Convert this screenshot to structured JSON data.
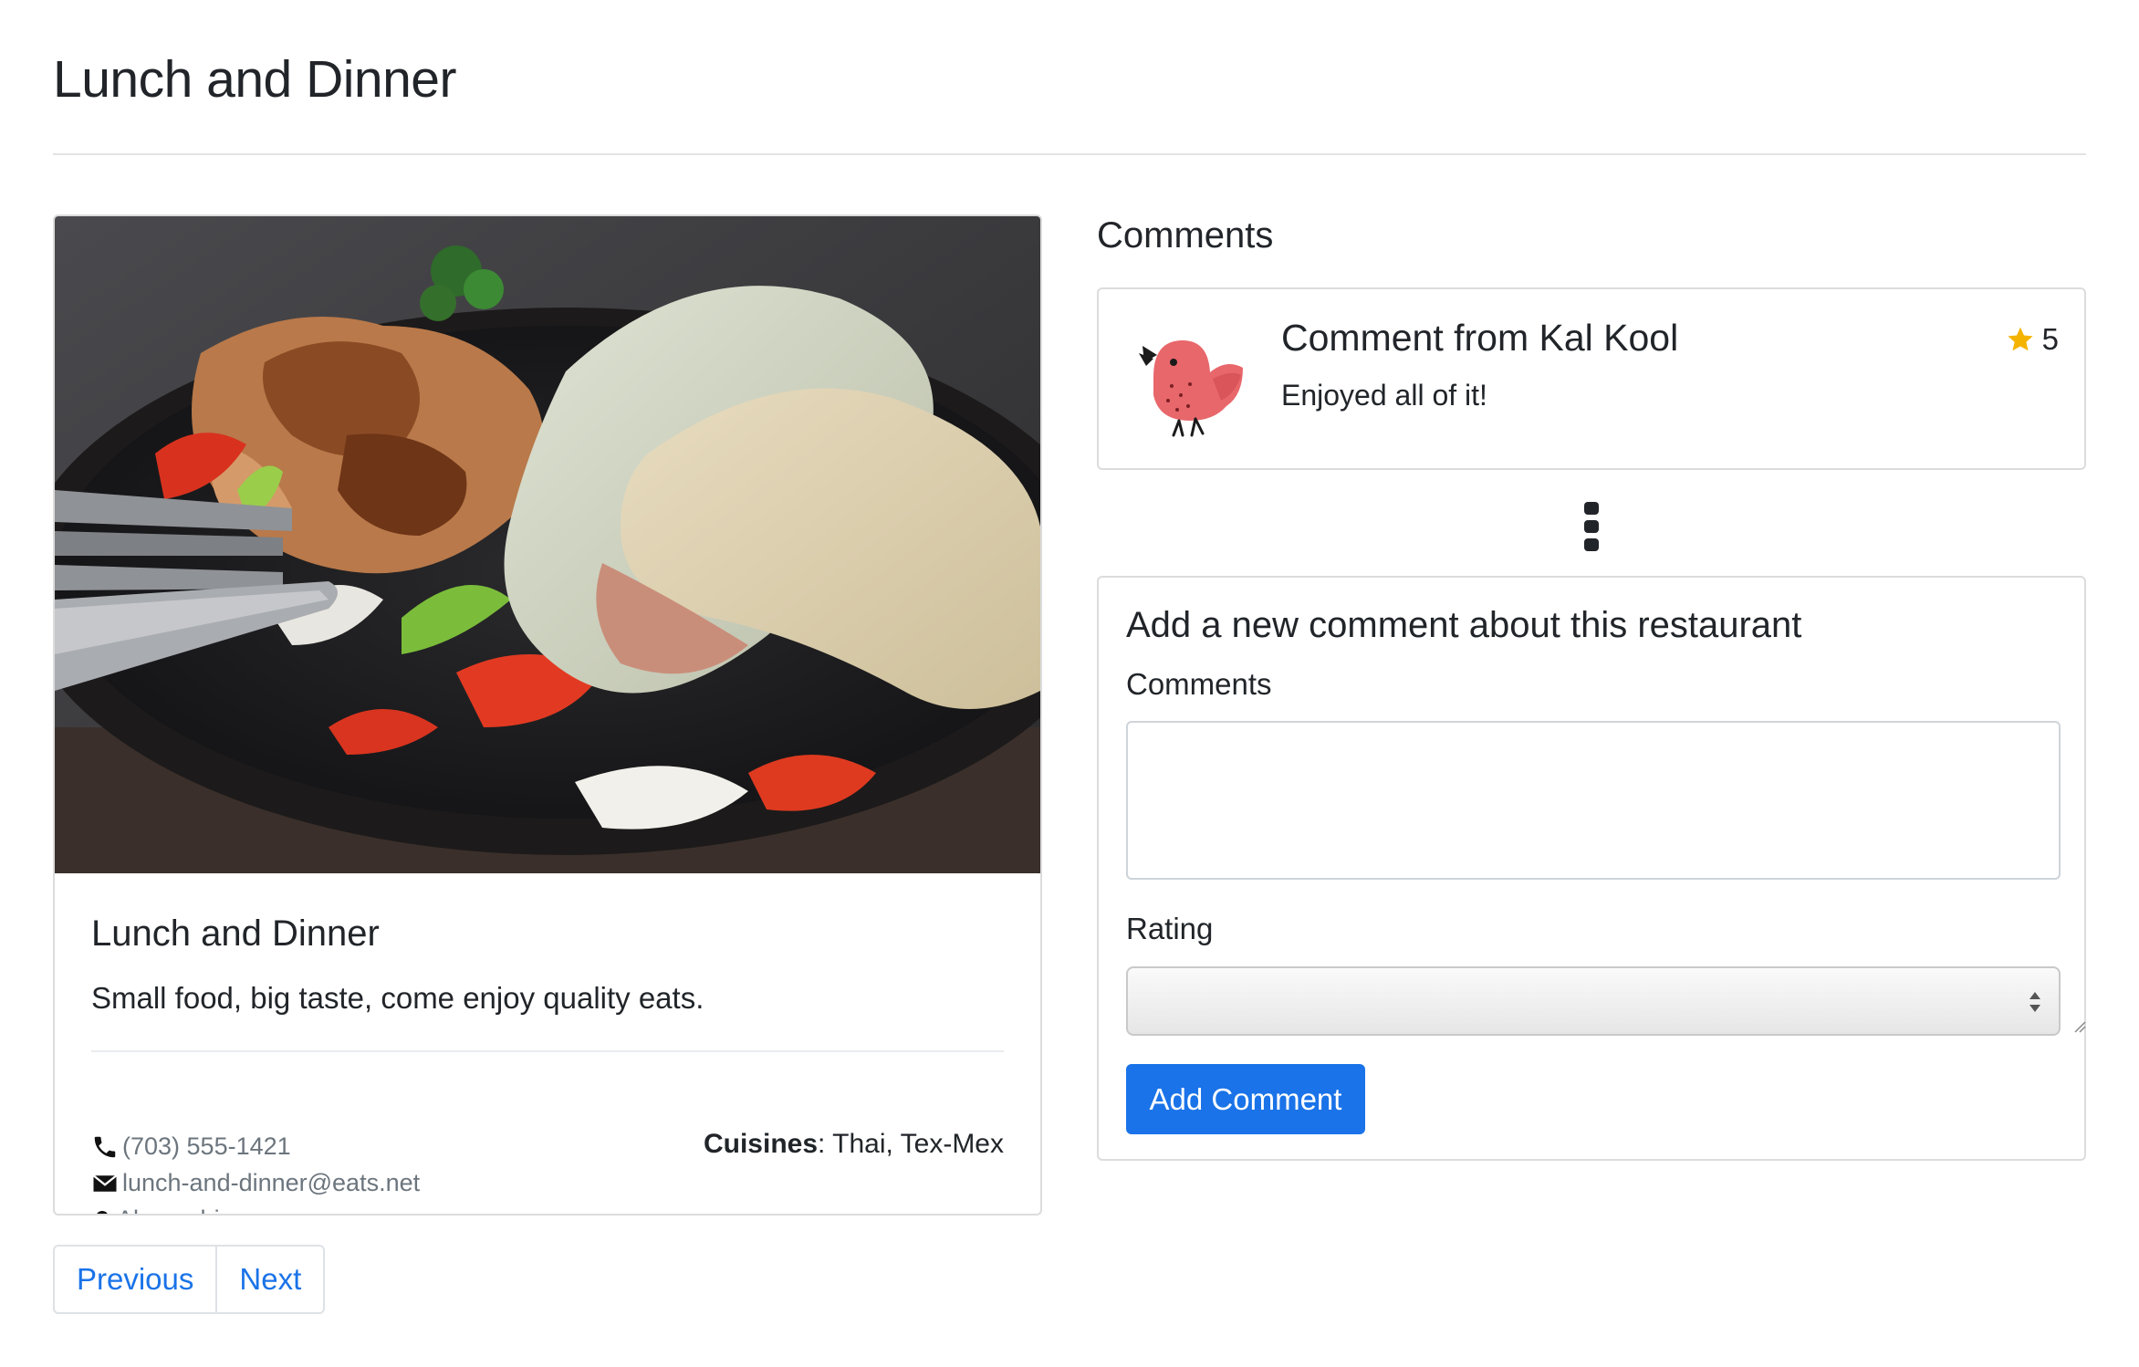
{
  "header": {
    "title": "Lunch and Dinner"
  },
  "restaurant": {
    "name": "Lunch and Dinner",
    "description": "Small food, big taste, come enjoy quality eats.",
    "phone": "(703) 555-1421",
    "email": "lunch-and-dinner@eats.net",
    "location": "Alexandria",
    "cuisines_label": "Cuisines",
    "cuisines_value": ": Thai, Tex-Mex",
    "image_icon": "food-photo"
  },
  "pagination": {
    "previous_label": "Previous",
    "next_label": "Next"
  },
  "comments": {
    "heading": "Comments",
    "items": [
      {
        "title": "Comment from Kal Kool",
        "body": "Enjoyed all of it!",
        "rating": "5",
        "avatar_icon": "bird-avatar"
      }
    ]
  },
  "form": {
    "title": "Add a new comment about this restaurant",
    "comments_label": "Comments",
    "comments_value": "",
    "rating_label": "Rating",
    "rating_value": "",
    "submit_label": "Add Comment"
  },
  "colors": {
    "accent": "#1a73e8",
    "star": "#f5b301",
    "avatar": "#e8676b"
  }
}
